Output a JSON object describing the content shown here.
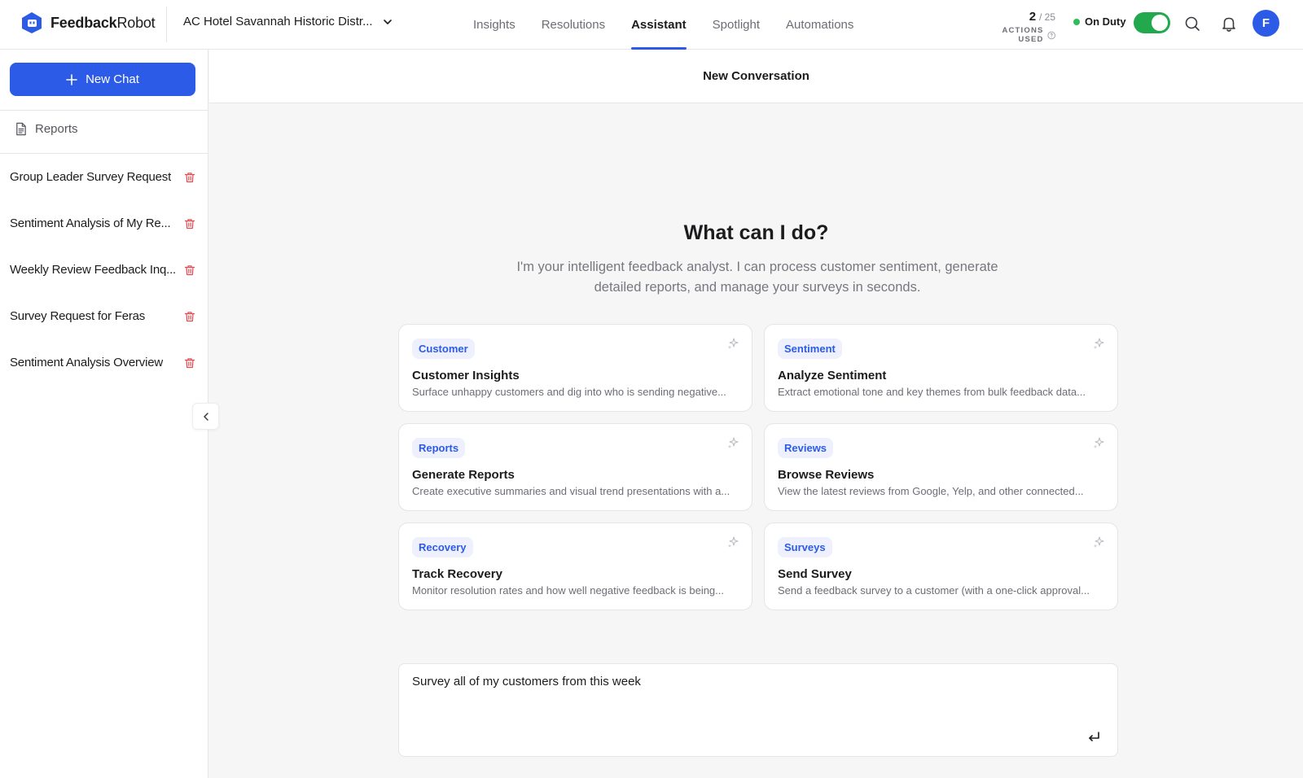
{
  "brand": {
    "name_bold": "Feedback",
    "name_regular": "Robot"
  },
  "property": {
    "name": "AC Hotel Savannah Historic Distr..."
  },
  "nav": [
    {
      "label": "Insights",
      "active": false
    },
    {
      "label": "Resolutions",
      "active": false
    },
    {
      "label": "Assistant",
      "active": true
    },
    {
      "label": "Spotlight",
      "active": false
    },
    {
      "label": "Automations",
      "active": false
    }
  ],
  "actions": {
    "used": "2",
    "total": "/ 25",
    "label": "ACTIONS USED"
  },
  "duty": {
    "label": "On Duty",
    "enabled": true,
    "color": "#22a84d"
  },
  "user": {
    "initial": "F"
  },
  "sidebar": {
    "new_chat_label": "New Chat",
    "reports_label": "Reports",
    "chats": [
      {
        "title": "Group Leader Survey Request"
      },
      {
        "title": "Sentiment Analysis of My Re..."
      },
      {
        "title": "Weekly Review Feedback Inq..."
      },
      {
        "title": "Survey Request for Feras"
      },
      {
        "title": "Sentiment Analysis Overview"
      }
    ]
  },
  "conversation": {
    "header": "New Conversation",
    "hero_title": "What can I do?",
    "hero_subtitle": "I'm your intelligent feedback analyst. I can process customer sentiment, generate detailed reports, and manage your surveys in seconds."
  },
  "cards": [
    {
      "tag": "Customer",
      "title": "Customer Insights",
      "desc": "Surface unhappy customers and dig into who is sending negative..."
    },
    {
      "tag": "Sentiment",
      "title": "Analyze Sentiment",
      "desc": "Extract emotional tone and key themes from bulk feedback data..."
    },
    {
      "tag": "Reports",
      "title": "Generate Reports",
      "desc": "Create executive summaries and visual trend presentations with a..."
    },
    {
      "tag": "Reviews",
      "title": "Browse Reviews",
      "desc": "View the latest reviews from Google, Yelp, and other connected..."
    },
    {
      "tag": "Recovery",
      "title": "Track Recovery",
      "desc": "Monitor resolution rates and how well negative feedback is being..."
    },
    {
      "tag": "Surveys",
      "title": "Send Survey",
      "desc": "Send a feedback survey to a customer (with a one-click approval..."
    }
  ],
  "composer": {
    "value": "Survey all of my customers from this week"
  },
  "colors": {
    "accent": "#2c5be8",
    "danger": "#e5484d",
    "success": "#22a84d"
  },
  "icons": [
    "logo-icon",
    "chevron-down-icon",
    "info-icon",
    "search-icon",
    "bell-icon",
    "plus-icon",
    "document-icon",
    "trash-icon",
    "chevron-left-icon",
    "sparkle-icon",
    "enter-icon"
  ]
}
